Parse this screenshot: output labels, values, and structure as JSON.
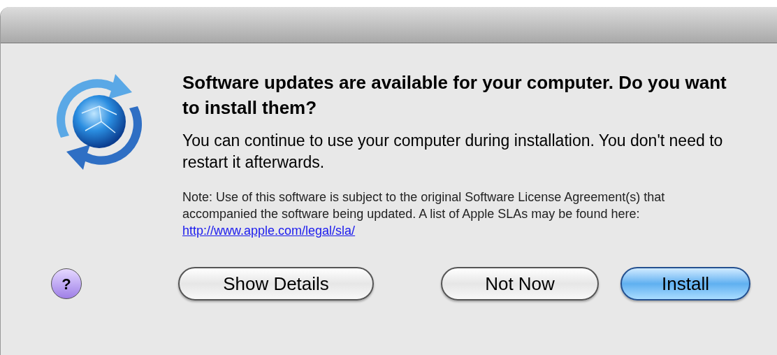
{
  "dialog": {
    "heading": "Software updates are available for your computer. Do you want to install them?",
    "message": "You can continue to use your computer during installation. You don't need to restart it afterwards.",
    "note": "Note: Use of this software is subject to the original Software License Agreement(s) that accompanied the software being updated. A list of Apple SLAs may be found here:",
    "link": "http://www.apple.com/legal/sla/"
  },
  "help_button": {
    "label": "?"
  },
  "buttons": [
    {
      "label": "Show Details",
      "default": false
    },
    {
      "label": "Not Now",
      "default": false
    },
    {
      "label": "Install",
      "default": true
    }
  ]
}
